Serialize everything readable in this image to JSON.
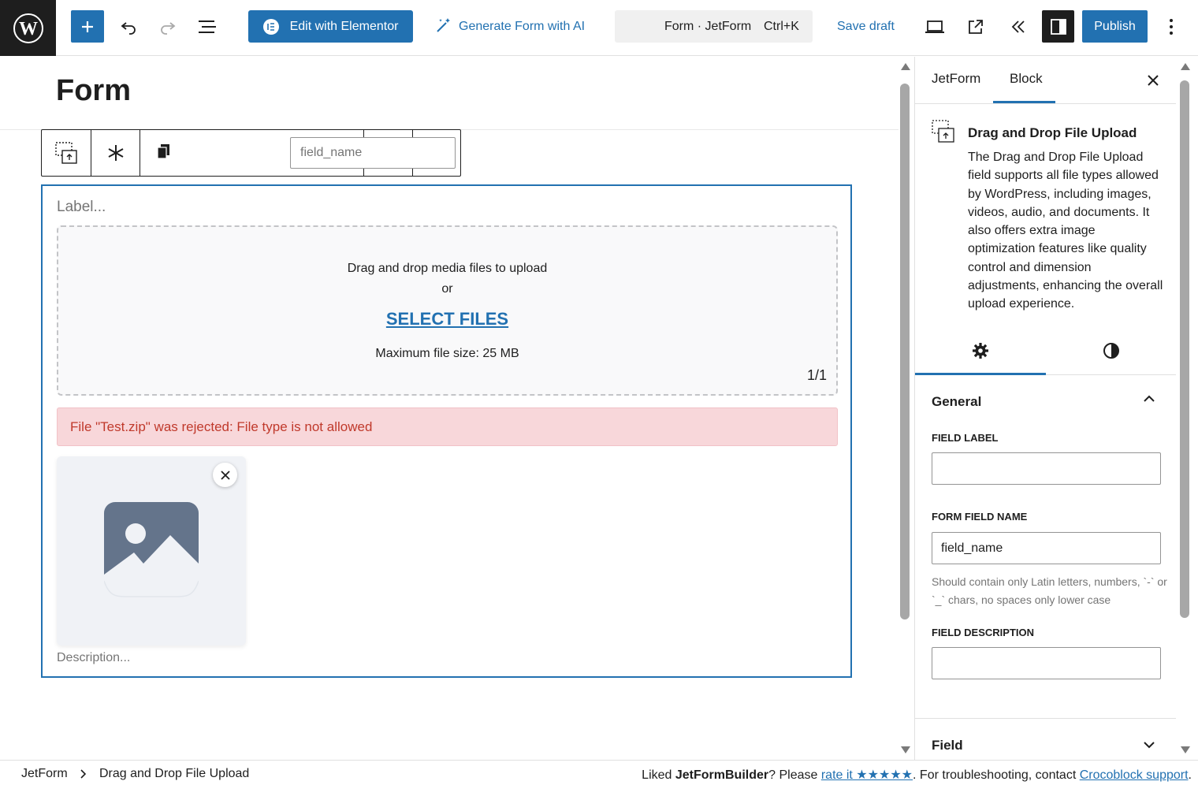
{
  "topbar": {
    "elementor_label": "Edit with Elementor",
    "ai_label": "Generate Form with AI",
    "command_title": "Form · JetForm",
    "command_shortcut": "Ctrl+K",
    "save_draft": "Save draft",
    "publish": "Publish"
  },
  "editor": {
    "page_title": "Form",
    "toolbar_field_value": "field_name",
    "label_placeholder": "Label...",
    "dropzone_text": "Drag and drop media files to upload",
    "dropzone_or": "or",
    "select_files": "SELECT FILES",
    "max_size": "Maximum file size: 25 MB",
    "counter": "1/1",
    "error": "File \"Test.zip\" was rejected: File type is not allowed",
    "description_placeholder": "Description..."
  },
  "sidebar": {
    "tabs": [
      "JetForm",
      "Block"
    ],
    "active_tab": "Block",
    "block_title": "Drag and Drop File Upload",
    "block_description": "The Drag and Drop File Upload field supports all file types allowed by WordPress, including images, videos, audio, and documents. It also offers extra image optimization features like quality control and dimension adjustments, enhancing the overall upload experience.",
    "general_heading": "General",
    "field_label_label": "FIELD LABEL",
    "field_label_value": "",
    "field_name_label": "FORM FIELD NAME",
    "field_name_value": "field_name",
    "field_name_help": "Should contain only Latin letters, numbers, `-` or `_` chars, no spaces only lower case",
    "field_desc_label": "FIELD DESCRIPTION",
    "field_desc_value": "",
    "field_heading": "Field"
  },
  "footer": {
    "crumbs": [
      "JetForm",
      "Drag and Drop File Upload"
    ],
    "note_prefix": "Liked ",
    "note_brand": "JetFormBuilder",
    "note_mid": "? Please ",
    "rate_link": "rate it ★★★★★",
    "note_mid2": ". For troubleshooting, contact ",
    "support_link": "Crocoblock support",
    "note_end": "."
  },
  "colors": {
    "accent": "#2271b1",
    "error_bg": "#f8d7da",
    "error_text": "#c0392b",
    "dark": "#1e1e1e"
  }
}
